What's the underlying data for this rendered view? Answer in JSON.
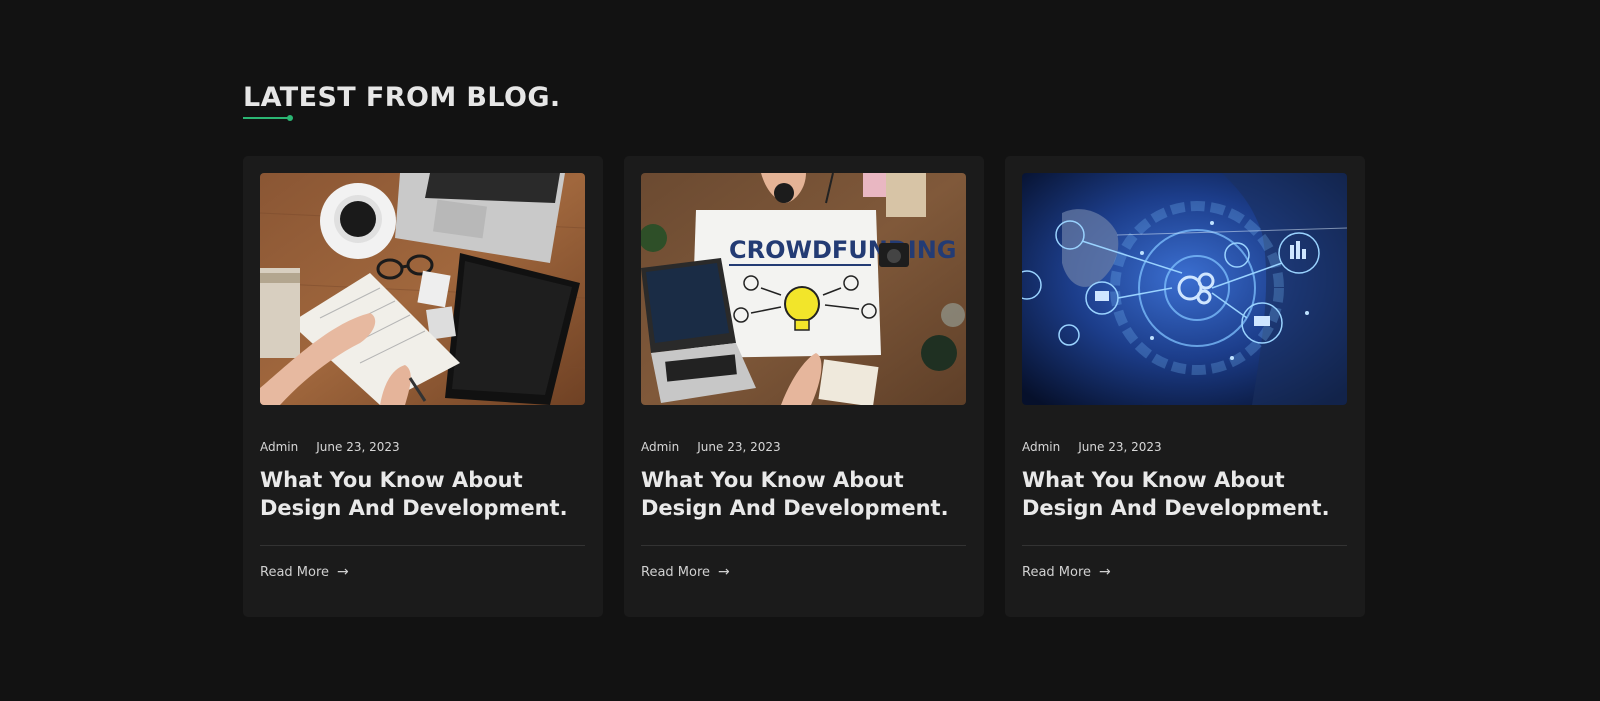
{
  "section": {
    "heading": "LATEST FROM BLOG.",
    "accent_color": "#2bb673"
  },
  "posts": [
    {
      "image": "desk-notebook-laptop-photo",
      "author": "Admin",
      "date": "June 23, 2023",
      "title": "What You Know About Design And Development.",
      "read_more": "Read More",
      "arrow_icon": "arrow-right-icon"
    },
    {
      "image": "crowdfunding-lightbulb-photo",
      "author": "Admin",
      "date": "June 23, 2023",
      "title": "What You Know About Design And Development.",
      "read_more": "Read More",
      "arrow_icon": "arrow-right-icon",
      "image_text": "CROWDFUNDING"
    },
    {
      "image": "tech-gears-hologram-photo",
      "author": "Admin",
      "date": "June 23, 2023",
      "title": "What You Know About Design And Development.",
      "read_more": "Read More",
      "arrow_icon": "arrow-right-icon"
    }
  ]
}
